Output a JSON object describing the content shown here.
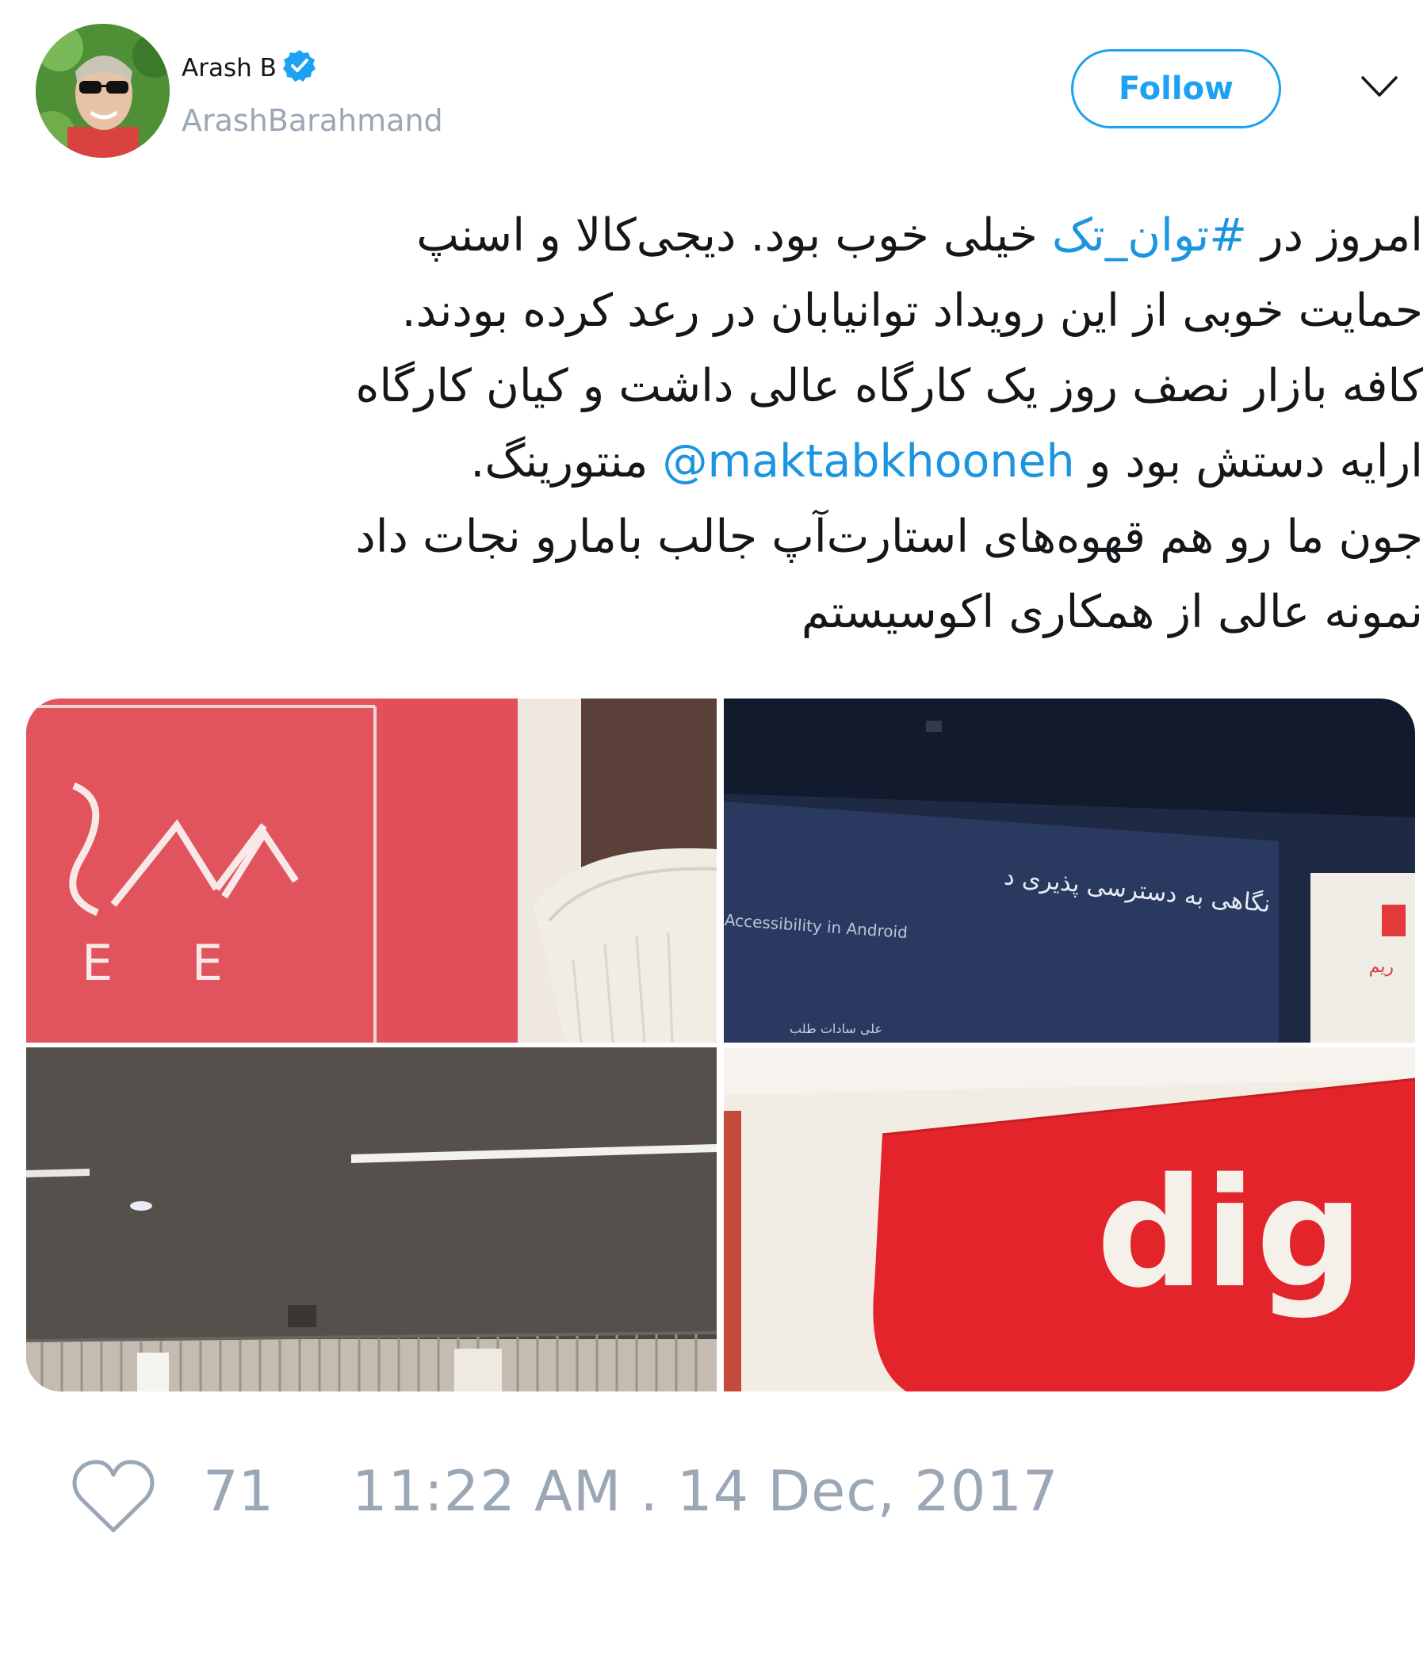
{
  "author": {
    "display_name": "Arash B",
    "handle": "ArashBarahmand",
    "verified_icon": "verified-badge-icon",
    "avatar_icon": "avatar"
  },
  "actions": {
    "follow_label": "Follow",
    "menu_icon": "chevron-down-icon"
  },
  "tweet": {
    "line1_prefix": "امروز در ",
    "hashtag": "#توان_تک",
    "line1_suffix": " خیلی خوب بود. دیجی‌کالا و اسنپ",
    "line2": "حمایت خوبی از این رویداد توانیابان در رعد کرده بودند.",
    "line3": "کافه بازار نصف روز یک کارگاه عالی داشت و کیان کارگاه",
    "line4_prefix": "ارایه دستش بود و ",
    "mention": "@maktabkhooneh",
    "line4_suffix": " منتورینگ.",
    "line5": "جون ما رو هم قهوه‌های استارت‌آپ جالب بامارو نجات داد",
    "line6": "نمونه عالی از همکاری اکوسیستم"
  },
  "media": {
    "photo_tl": {
      "letters": "E E"
    },
    "photo_tr": {
      "slide_title_fa": "نگاهی به دسترسی پذیری د",
      "slide_subtitle_en": "Accessibility in Android",
      "slide_presenter_fa": "علی سادات طلب",
      "banner_text_fa": "ریم"
    },
    "photo_bl": {},
    "photo_br": {
      "logo_text": "dig"
    }
  },
  "footer": {
    "heart_icon": "heart-icon",
    "like_count": "71",
    "timestamp": "11:22 AM . 14 Dec, 2017"
  },
  "colors": {
    "accent": "#1da1f2",
    "link": "#1b95e0",
    "muted": "#9aa7b6",
    "text": "#14171a",
    "brand_red": "#e5464f"
  }
}
